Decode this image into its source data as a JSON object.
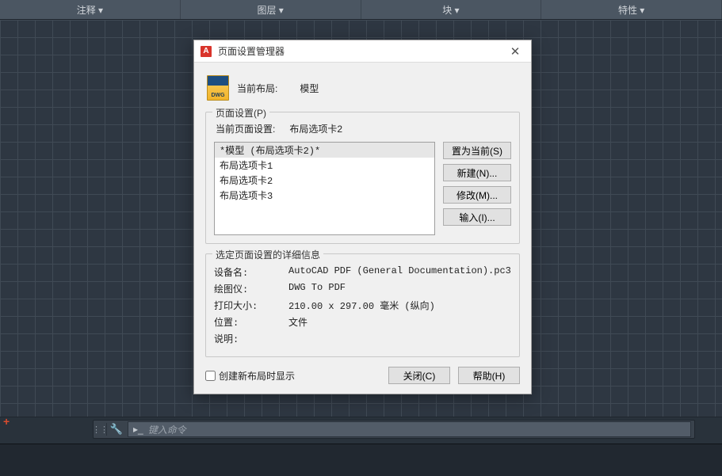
{
  "toolbar_tabs": [
    "注释 ▾",
    "图层 ▾",
    "块 ▾",
    "特性 ▾"
  ],
  "command_placeholder": "键入命令",
  "dialog": {
    "title": "页面设置管理器",
    "current_layout_label": "当前布局:",
    "current_layout_value": "模型",
    "group_page_setup_title": "页面设置(P)",
    "current_setup_label": "当前页面设置:",
    "current_setup_value": "布局选项卡2",
    "list_items": [
      "*模型 (布局选项卡2)*",
      "布局选项卡1",
      "布局选项卡2",
      "布局选项卡3"
    ],
    "selected_index": 0,
    "btn_set_current": "置为当前(S)",
    "btn_new": "新建(N)...",
    "btn_modify": "修改(M)...",
    "btn_import": "输入(I)...",
    "group_detail_title": "选定页面设置的详细信息",
    "detail": {
      "device_label": "设备名:",
      "device_value": "AutoCAD PDF (General Documentation).pc3",
      "plotter_label": "绘图仪:",
      "plotter_value": "DWG To PDF",
      "size_label": "打印大小:",
      "size_value": "210.00 x 297.00 毫米 (纵向)",
      "where_label": "位置:",
      "where_value": "文件",
      "desc_label": "说明:",
      "desc_value": ""
    },
    "checkbox_label": "创建新布局时显示",
    "btn_close": "关闭(C)",
    "btn_help": "帮助(H)"
  }
}
